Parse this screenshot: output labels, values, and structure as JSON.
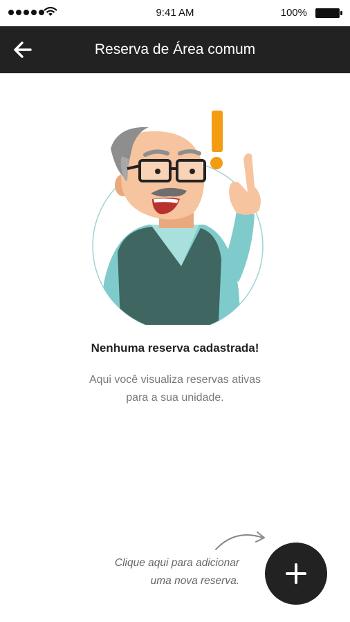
{
  "status_bar": {
    "time": "9:41 AM",
    "battery": "100%"
  },
  "app_bar": {
    "title": "Reserva de Área comum",
    "back_icon": "arrow-left-icon"
  },
  "empty_state": {
    "title": "Nenhuma reserva cadastrada!",
    "description_line1": "Aqui você visualiza reservas ativas",
    "description_line2": "para a sua unidade."
  },
  "hint": {
    "line1": "Clique aqui para adicionar",
    "line2": "uma nova reserva."
  },
  "fab": {
    "icon": "plus-icon"
  },
  "colors": {
    "app_bar": "#222222",
    "fab": "#222222",
    "accent": "#F39C12",
    "shirt": "#7FCBCB",
    "vest": "#3F6660"
  }
}
